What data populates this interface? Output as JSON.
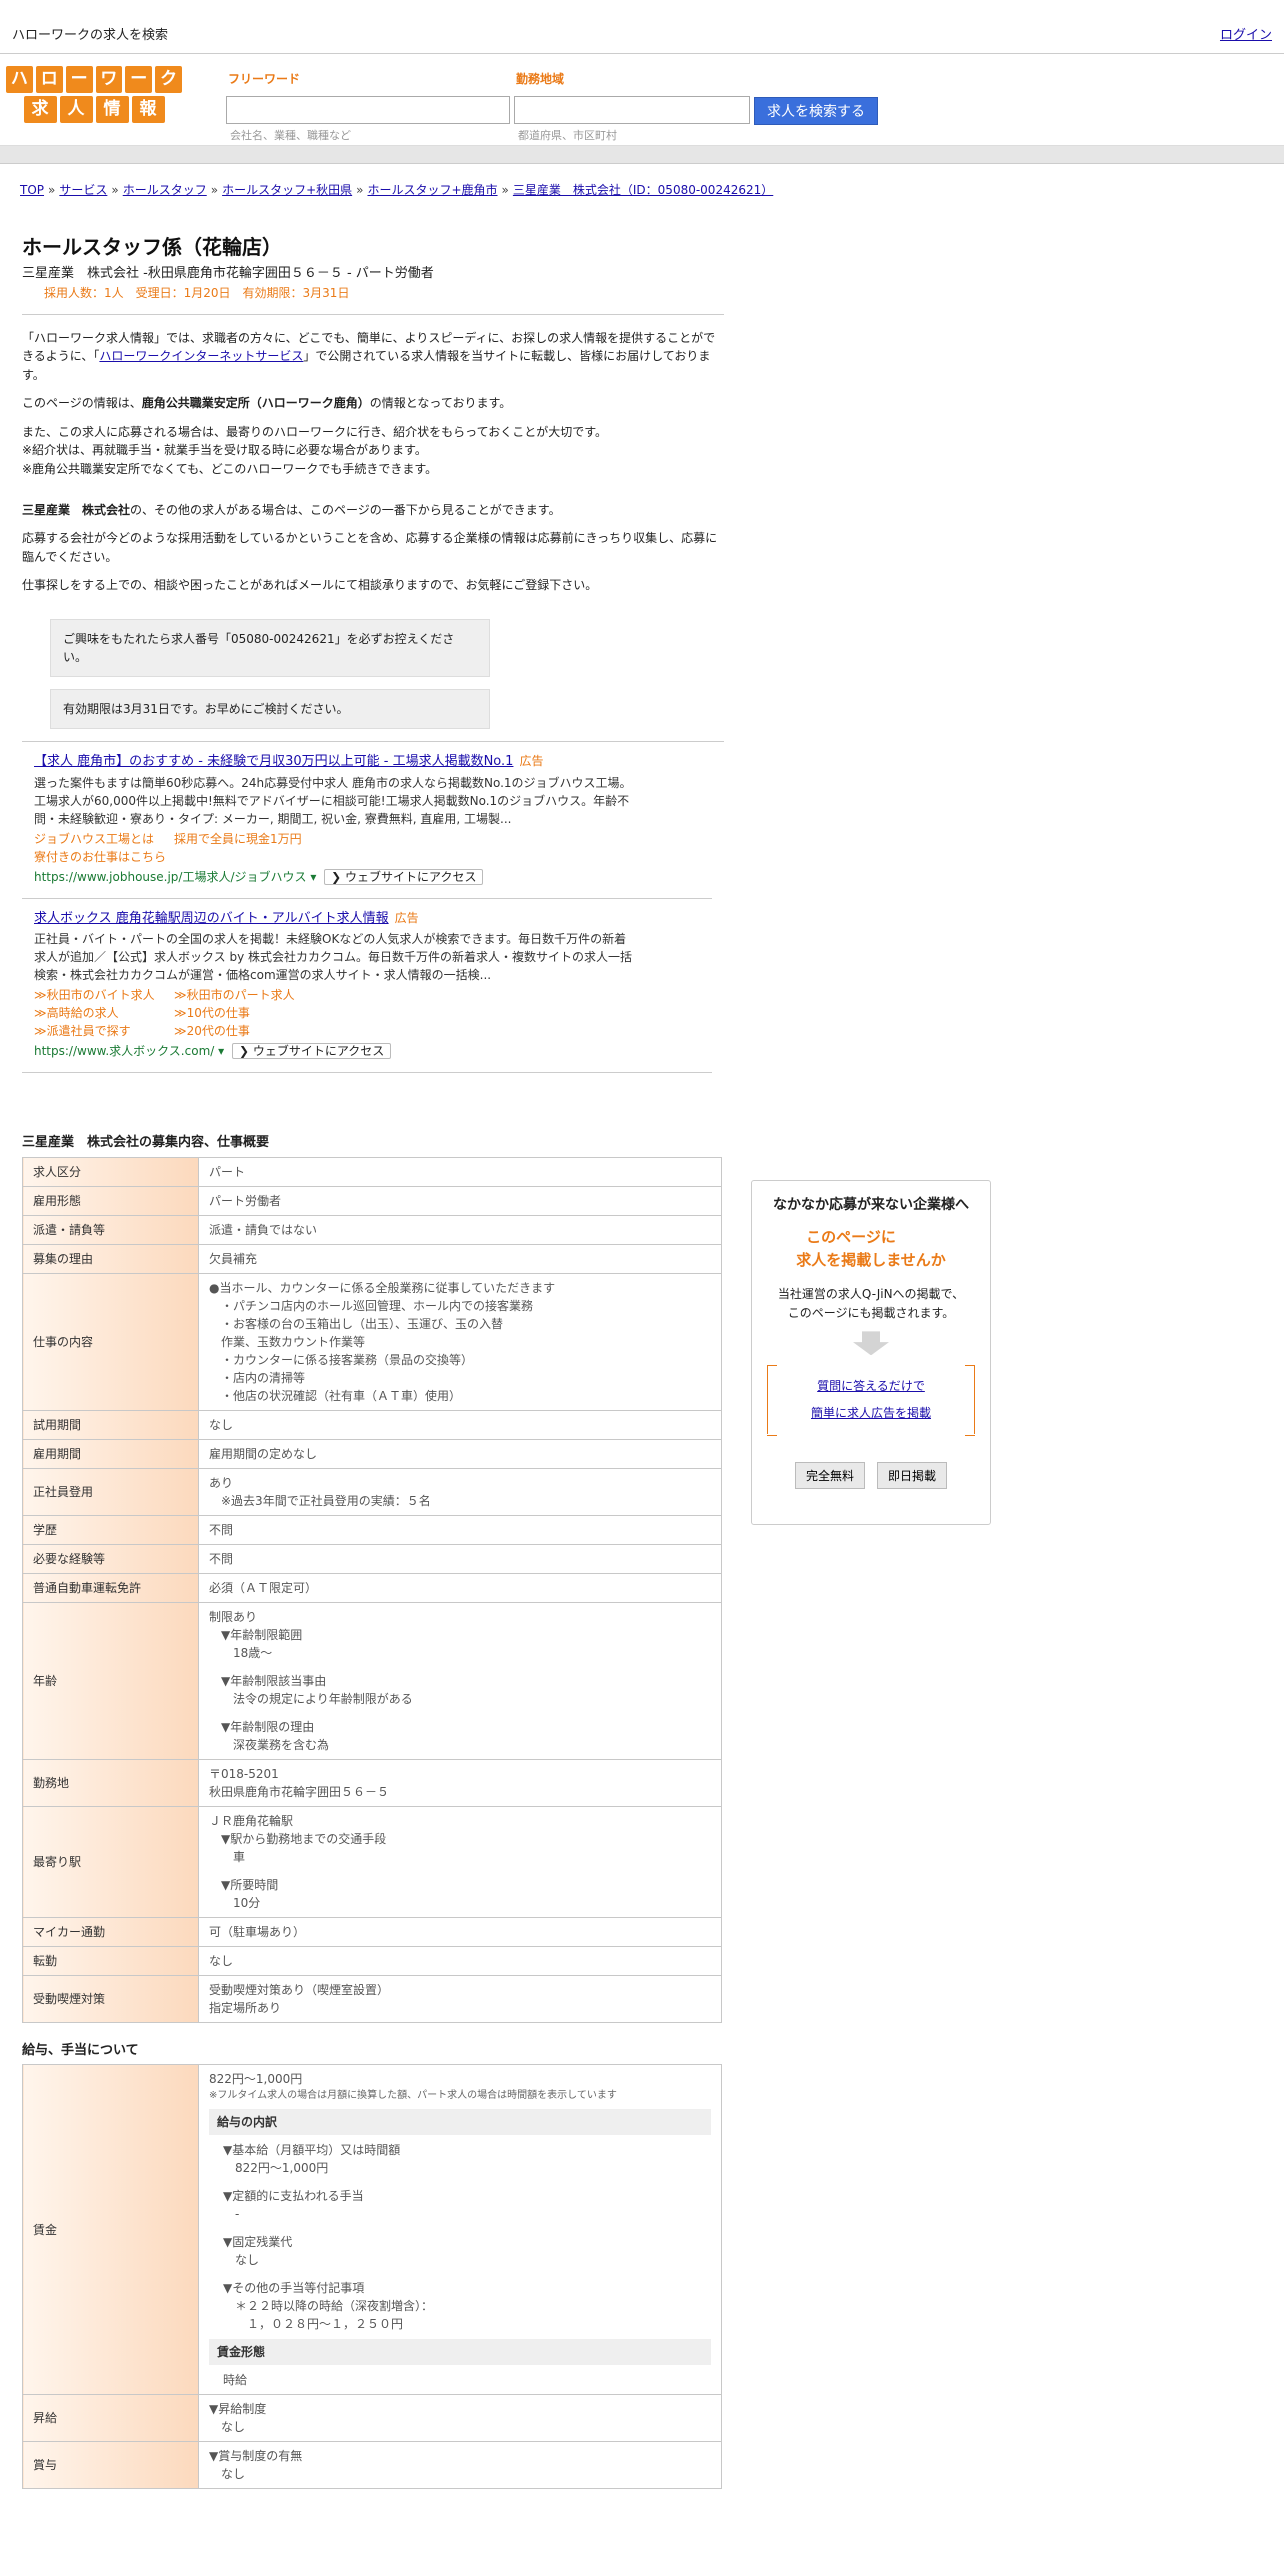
{
  "topbar": {
    "site_title": "ハローワークの求人を検索",
    "login": "ログイン"
  },
  "logo": {
    "row1": [
      "ハ",
      "ロ",
      "ー",
      "ワ",
      "ー",
      "ク"
    ],
    "row2": [
      "求",
      "人",
      "情",
      "報"
    ]
  },
  "search": {
    "freeword_label": "フリーワード",
    "freeword_hint": "会社名、業種、職種など",
    "area_label": "勤務地域",
    "area_hint": "都道府県、市区町村",
    "button": "求人を検索する"
  },
  "breadcrumb": [
    "TOP",
    "サービス",
    "ホールスタッフ",
    "ホールスタッフ+秋田県",
    "ホールスタッフ+鹿角市",
    "三星産業　株式会社（ID：05080-00242621）"
  ],
  "job": {
    "title": "ホールスタッフ係（花輪店）",
    "subtitle": "三星産業　株式会社 -秋田県鹿角市花輪字囲田５６－５ - パート労働者",
    "meta": "採用人数：1人　受理日：1月20日　有効期限：3月31日"
  },
  "intro": {
    "p1a": "「ハローワーク求人情報」では、求職者の方々に、どこでも、簡単に、よりスピーディに、お探しの求人情報を提供することができるように、「",
    "p1link": "ハローワークインターネットサービス",
    "p1b": "」で公開されている求人情報を当サイトに転載し、皆様にお届けしております。",
    "p2a": "このページの情報は、",
    "p2b": "鹿角公共職業安定所（ハローワーク鹿角）",
    "p2c": "の情報となっております。",
    "p3": "また、この求人に応募される場合は、最寄りのハローワークに行き、紹介状をもらっておくことが大切です。",
    "p3b": "※紹介状は、再就職手当・就業手当を受け取る時に必要な場合があります。",
    "p3c": "※鹿角公共職業安定所でなくても、どこのハローワークでも手続きできます。",
    "p4a": "三星産業　株式会社",
    "p4b": "の、その他の求人がある場合は、このページの一番下から見ることができます。",
    "p5": "応募する会社が今どのような採用活動をしているかということを含め、応募する企業様の情報は応募前にきっちり収集し、応募に臨んでください。",
    "p6": "仕事探しをする上での、相談や困ったことがあればメールにて相談承りますので、お気軽にご登録下さい。",
    "note1": "ご興味をもたれたら求人番号「05080-00242621」を必ずお控えください。",
    "note2": "有効期限は3月31日です。お早めにご検討ください。"
  },
  "ads": [
    {
      "title": "【求人 鹿角市】のおすすめ - 未経験で月収30万円以上可能 - 工場求人掲載数No.1",
      "tag": "広告",
      "desc": "選った案件もますは簡単60秒応募へ。24h応募受付中求人 鹿角市の求人なら掲載数No.1のジョブハウス工場。工場求人が60,000件以上掲載中!無料でアドバイザーに相談可能!工場求人掲載数No.1のジョブハウス。年齢不問・未経験歓迎・寮あり・タイプ: メーカー, 期間工, 祝い金, 寮費無料, 直雇用, 工場製...",
      "subs": [
        "ジョブハウス工場とは",
        "採用で全員に現金1万円",
        "寮付きのお仕事はこちら"
      ],
      "url": "https://www.jobhouse.jp/工場求人/ジョブハウス",
      "visit": "❯ ウェブサイトにアクセス"
    },
    {
      "title": "求人ボックス 鹿角花輪駅周辺のバイト・アルバイト求人情報",
      "tag": "広告",
      "desc": "正社員・バイト・パートの全国の求人を掲載！未経験OKなどの人気求人が検索できます。毎日数千万件の新着求人が追加／【公式】求人ボックス by 株式会社カカクコム。毎日数千万件の新着求人・複数サイトの求人一括検索・株式会社カカクコムが運営・価格com運営の求人サイト・求人情報の一括検...",
      "subs": [
        "≫秋田市のバイト求人",
        "≫秋田市のパート求人",
        "≫高時給の求人",
        "≫10代の仕事",
        "≫派遣社員で探す",
        "≫20代の仕事"
      ],
      "url": "https://www.求人ボックス.com/",
      "visit": "❯ ウェブサイトにアクセス"
    }
  ],
  "overview": {
    "heading": "三星産業　株式会社の募集内容、仕事概要",
    "rows": [
      {
        "k": "求人区分",
        "v": [
          "パート"
        ]
      },
      {
        "k": "雇用形態",
        "v": [
          "パート労働者"
        ]
      },
      {
        "k": "派遣・請負等",
        "v": [
          "派遣・請負ではない"
        ]
      },
      {
        "k": "募集の理由",
        "v": [
          "欠員補充"
        ]
      },
      {
        "k": "仕事の内容",
        "v": [
          "●当ホール、カウンターに係る全般業務に従事していただきます",
          "　・パチンコ店内のホール巡回管理、ホール内での接客業務",
          "　・お客様の台の玉箱出し（出玉）、玉運び、玉の入替",
          "　作業、玉数カウント作業等",
          "　・カウンターに係る接客業務（景品の交換等）",
          "　・店内の清掃等",
          "　・他店の状況確認（社有車（ＡＴ車）使用）"
        ]
      },
      {
        "k": "試用期間",
        "v": [
          "なし"
        ]
      },
      {
        "k": "雇用期間",
        "v": [
          "雇用期間の定めなし"
        ]
      },
      {
        "k": "正社員登用",
        "v": [
          "あり",
          "　※過去3年間で正社員登用の実績：５名"
        ]
      },
      {
        "k": "学歴",
        "v": [
          "不問"
        ]
      },
      {
        "k": "必要な経験等",
        "v": [
          "不問"
        ]
      },
      {
        "k": "普通自動車運転免許",
        "v": [
          "必須（ＡＴ限定可）"
        ]
      },
      {
        "k": "年齢",
        "v": [
          "制限あり",
          "　▼年齢制限範囲",
          "　　18歳～",
          "",
          "　▼年齢制限該当事由",
          "　　法令の規定により年齢制限がある",
          "",
          "　▼年齢制限の理由",
          "　　深夜業務を含む為"
        ]
      },
      {
        "k": "勤務地",
        "v": [
          "〒018-5201",
          "秋田県鹿角市花輪字囲田５６－５"
        ]
      },
      {
        "k": "最寄り駅",
        "v": [
          "ＪＲ鹿角花輪駅",
          "　▼駅から勤務地までの交通手段",
          "　　車",
          "",
          "　▼所要時間",
          "　　10分"
        ]
      },
      {
        "k": "マイカー通勤",
        "v": [
          "可（駐車場あり）"
        ]
      },
      {
        "k": "転勤",
        "v": [
          "なし"
        ]
      },
      {
        "k": "受動喫煙対策",
        "v": [
          "受動喫煙対策あり（喫煙室設置）",
          "指定場所あり"
        ]
      }
    ]
  },
  "salary": {
    "heading": "給与、手当について",
    "wage_key": "賃金",
    "wage_main": "822円〜1,000円",
    "wage_note": "※フルタイム求人の場合は月額に換算した額、パート求人の場合は時間額を表示しています",
    "breakdown_title": "給与の内訳",
    "breakdown": [
      "▼基本給（月額平均）又は時間額",
      "　822円〜1,000円",
      "",
      "▼定額的に支払われる手当",
      "　-",
      "",
      "▼固定残業代",
      "　なし",
      "",
      "▼その他の手当等付記事項",
      "　＊２２時以降の時給（深夜割増含）：",
      "　　１，０２８円～１，２５０円"
    ],
    "form_title": "賃金形態",
    "form_value": "時給",
    "raise_key": "昇給",
    "raise": [
      "▼昇給制度",
      "　なし"
    ],
    "bonus_key": "賞与",
    "bonus": [
      "▼賞与制度の有無",
      "　なし"
    ]
  },
  "side": {
    "heading": "なかなか応募が来ない企業様へ",
    "offer1": "このページに",
    "offer2": "求人を掲載しませんか",
    "desc1": "当社運営の求人Q-JiNへの掲載で、",
    "desc2": "このページにも掲載されます。",
    "link1": "質問に答えるだけで",
    "link2": "簡単に求人広告を掲載",
    "btn1": "完全無料",
    "btn2": "即日掲載"
  }
}
